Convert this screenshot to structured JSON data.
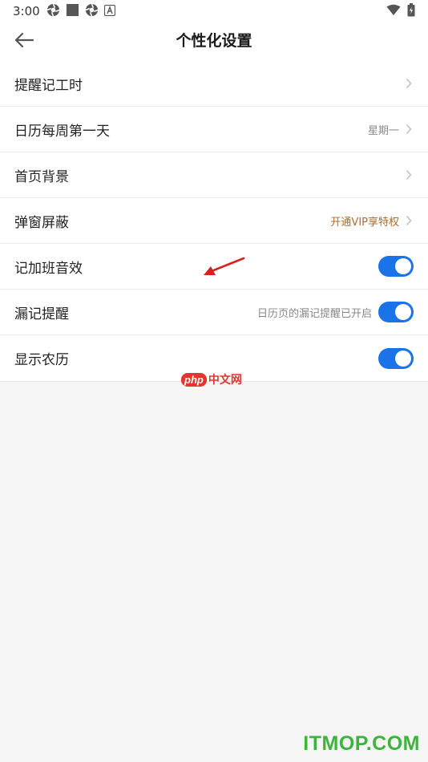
{
  "status_bar": {
    "time": "3:00",
    "left_icons": [
      "aperture-icon",
      "square-icon",
      "aperture-icon",
      "a-letter-icon"
    ],
    "right_icons": [
      "wifi-icon",
      "battery-icon"
    ]
  },
  "header": {
    "title": "个性化设置",
    "back_icon": "arrow-left-icon"
  },
  "settings": [
    {
      "label": "提醒记工时",
      "value": "",
      "control": "chevron"
    },
    {
      "label": "日历每周第一天",
      "value": "星期一",
      "control": "chevron"
    },
    {
      "label": "首页背景",
      "value": "",
      "control": "chevron"
    },
    {
      "label": "弹窗屏蔽",
      "value": "开通VIP享特权",
      "control": "chevron"
    },
    {
      "label": "记加班音效",
      "value": "",
      "control": "toggle",
      "toggle_on": true
    },
    {
      "label": "漏记提醒",
      "value": "日历页的漏记提醒已开启",
      "control": "toggle",
      "toggle_on": true
    },
    {
      "label": "显示农历",
      "value": "",
      "control": "toggle",
      "toggle_on": true
    }
  ],
  "colors": {
    "toggle_on": "#1a73e8",
    "vip_text": "#b06a2a",
    "annotation_arrow": "#d92020"
  },
  "watermarks": {
    "php_badge": "php",
    "php_text": "中文网",
    "site": "ITMOP.COM"
  }
}
